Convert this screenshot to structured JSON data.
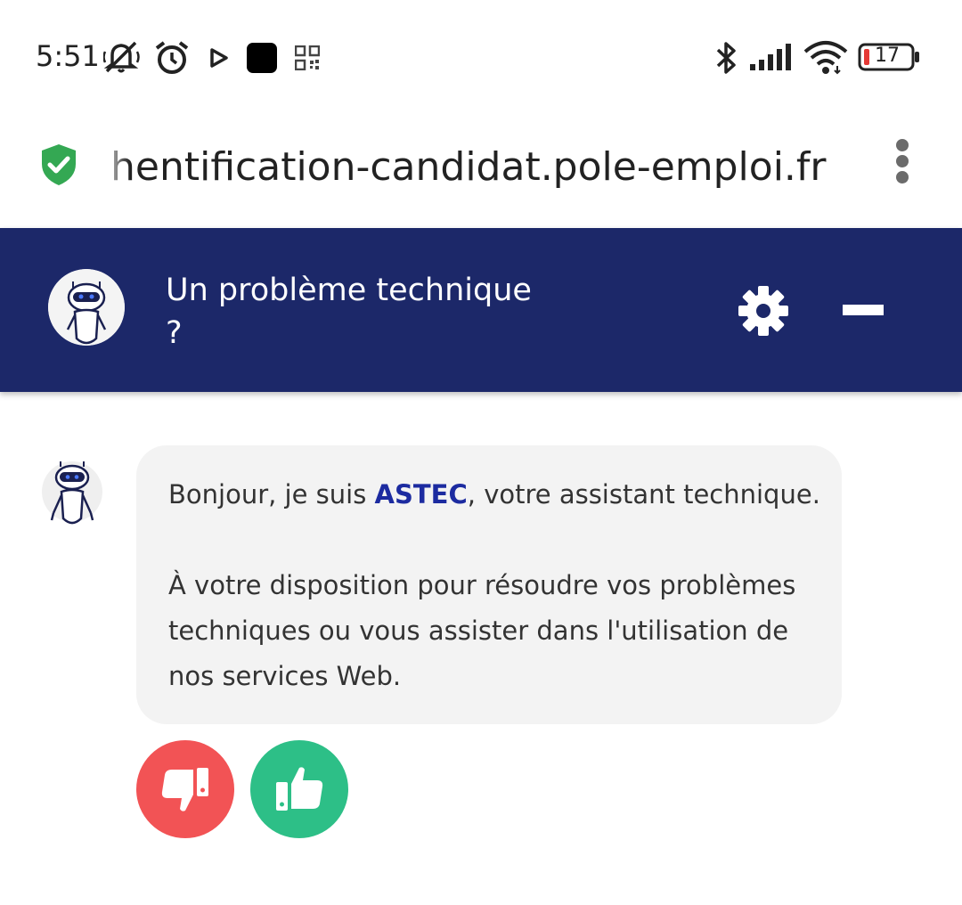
{
  "status_bar": {
    "time": "5:51",
    "battery_level": "17",
    "icons": [
      "mute-icon",
      "alarm-icon",
      "play-icon",
      "app-square-icon",
      "qr-icon",
      "bluetooth-icon",
      "signal-icon",
      "wifi-icon",
      "battery-icon"
    ]
  },
  "browser": {
    "url": "hentification-candidat.pole-emploi.fr",
    "secure_icon": "shield-check-icon",
    "menu_icon": "more-vert-icon"
  },
  "chat_header": {
    "title_line1": "Un problème technique",
    "title_line2": "?",
    "settings_icon": "gear-icon",
    "minimize_icon": "minimize-icon",
    "background_color": "#1c2869"
  },
  "message": {
    "greeting_prefix": "Bonjour, je suis ",
    "bot_name": "ASTEC",
    "greeting_suffix": ", votre assistant technique.",
    "body": "À votre disposition pour résoudre vos problèmes techniques ou vous assister dans l'utilisation de nos services Web."
  },
  "feedback": {
    "dislike_icon": "thumbs-down-icon",
    "like_icon": "thumbs-up-icon",
    "dislike_color": "#f25355",
    "like_color": "#2dbf87"
  }
}
